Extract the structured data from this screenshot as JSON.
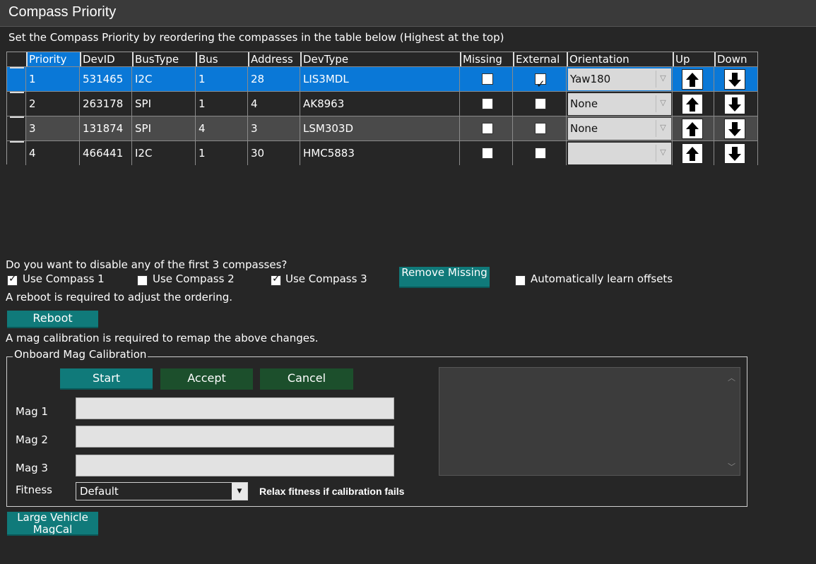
{
  "window": {
    "title": "Compass Priority"
  },
  "instructions": "Set the Compass Priority by reordering the compasses in the table below (Highest at the top)",
  "table": {
    "columns": [
      "Priority",
      "DevID",
      "BusType",
      "Bus",
      "Address",
      "DevType",
      "Missing",
      "External",
      "Orientation",
      "Up",
      "Down"
    ],
    "rows": [
      {
        "priority": "1",
        "devid": "531465",
        "bustype": "I2C",
        "bus": "1",
        "address": "28",
        "devtype": "LIS3MDL",
        "missing": false,
        "external": true,
        "orientation": "Yaw180"
      },
      {
        "priority": "2",
        "devid": "263178",
        "bustype": "SPI",
        "bus": "1",
        "address": "4",
        "devtype": "AK8963",
        "missing": false,
        "external": false,
        "orientation": "None"
      },
      {
        "priority": "3",
        "devid": "131874",
        "bustype": "SPI",
        "bus": "4",
        "address": "3",
        "devtype": "LSM303D",
        "missing": false,
        "external": false,
        "orientation": "None"
      },
      {
        "priority": "4",
        "devid": "466441",
        "bustype": "I2C",
        "bus": "1",
        "address": "30",
        "devtype": "HMC5883",
        "missing": false,
        "external": false,
        "orientation": ""
      }
    ]
  },
  "disable_prompt": "Do you want to disable any of the first 3 compasses?",
  "use_compass": [
    {
      "label": "Use Compass 1",
      "checked": true
    },
    {
      "label": "Use Compass 2",
      "checked": false
    },
    {
      "label": "Use Compass 3",
      "checked": true
    }
  ],
  "remove_missing_label": "Remove Missing",
  "auto_learn": {
    "label": "Automatically learn offsets",
    "checked": false
  },
  "reboot_note": "A reboot is required to adjust the ordering.",
  "reboot_label": "Reboot",
  "magcal_note": "A mag calibration is required to remap the above changes.",
  "onboard": {
    "title": "Onboard Mag Calibration",
    "start_label": "Start",
    "accept_label": "Accept",
    "cancel_label": "Cancel",
    "mag_labels": [
      "Mag 1",
      "Mag 2",
      "Mag 3"
    ],
    "mag_values": [
      "",
      "",
      ""
    ],
    "fitness_label": "Fitness",
    "fitness_value": "Default",
    "relax_note": "Relax fitness if calibration fails"
  },
  "large_vehicle_label": "Large Vehicle MagCal",
  "colors": {
    "accent": "#0a78d7",
    "teal_button": "#107a7a",
    "green_button": "#1c4f2c",
    "background": "#262626"
  },
  "icons": {
    "up": "arrow-up-icon",
    "down": "arrow-down-icon"
  }
}
